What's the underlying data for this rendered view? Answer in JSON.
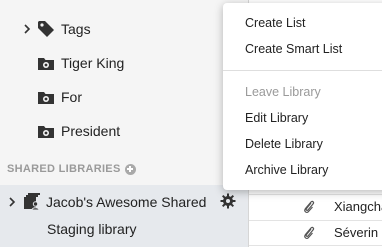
{
  "sidebar": {
    "items": [
      {
        "label": "Tags",
        "icon": "tag-icon"
      },
      {
        "label": "Tiger King",
        "icon": "smart-folder-icon"
      },
      {
        "label": "For",
        "icon": "smart-folder-icon"
      },
      {
        "label": "President",
        "icon": "smart-folder-icon"
      }
    ],
    "section_header": "SHARED LIBRARIES",
    "shared": [
      {
        "label": "Jacob's Awesome Shared",
        "icon": "shared-library-icon"
      },
      {
        "label": "Staging library"
      }
    ]
  },
  "items_list": [
    {
      "text": "Xiangcha",
      "icon": "attachment-icon"
    },
    {
      "text": "Séverin L",
      "icon": "attachment-icon"
    }
  ],
  "context_menu": {
    "items": [
      {
        "label": "Create List",
        "enabled": true
      },
      {
        "label": "Create Smart List",
        "enabled": true
      },
      {
        "label": "Leave Library",
        "enabled": false
      },
      {
        "label": "Edit Library",
        "enabled": true
      },
      {
        "label": "Delete Library",
        "enabled": true
      },
      {
        "label": "Archive Library",
        "enabled": true
      }
    ]
  },
  "colors": {
    "sidebar_bg": "#f5f5f5",
    "selected_row_bg": "#e6e9ed",
    "section_text": "#9a9a9a",
    "disabled_text": "#9a9a9a"
  }
}
